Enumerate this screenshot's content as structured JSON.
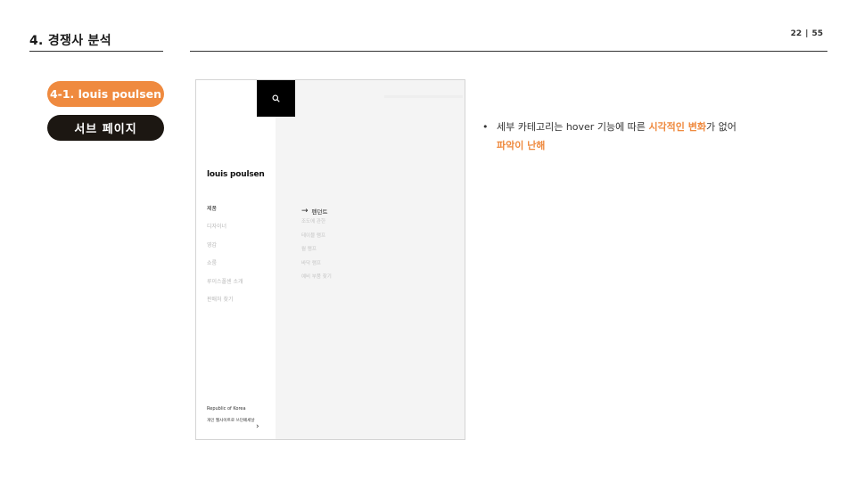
{
  "header": {
    "section_title": "4. 경쟁사 분석",
    "page_current": "22",
    "page_separator": "|",
    "page_total": "55"
  },
  "labels": {
    "brand_pill": "4-1. louis poulsen",
    "page_pill": "서브 페이지"
  },
  "screenshot": {
    "logo": "louis poulsen",
    "menu_items": [
      "제품",
      "디자이너",
      "영감",
      "쇼룸",
      "루이스폴센 소개",
      "판매처 찾기"
    ],
    "submenu_title": "펜던트",
    "submenu_arrow": "→",
    "submenu_items": [
      "조도에 관한",
      "테이블 램프",
      "월 램프",
      "바닥 램프",
      "예비 부품 찾기"
    ],
    "country": "Republic of Korea",
    "store_text": "개인 웹사이트로 쓰던페세날",
    "chevron": "›",
    "icons": {
      "search": "search-icon"
    }
  },
  "note": {
    "bullet": "•",
    "text_before": "세부 카테고리는 hover 기능에 따른 ",
    "highlight_1": "시각적인 변화",
    "text_after": "가 없어",
    "highlight_2": "파악이 난해"
  },
  "colors": {
    "accent": "#ef8a3f",
    "dark_pill": "#1c1712",
    "rule": "#333333"
  }
}
